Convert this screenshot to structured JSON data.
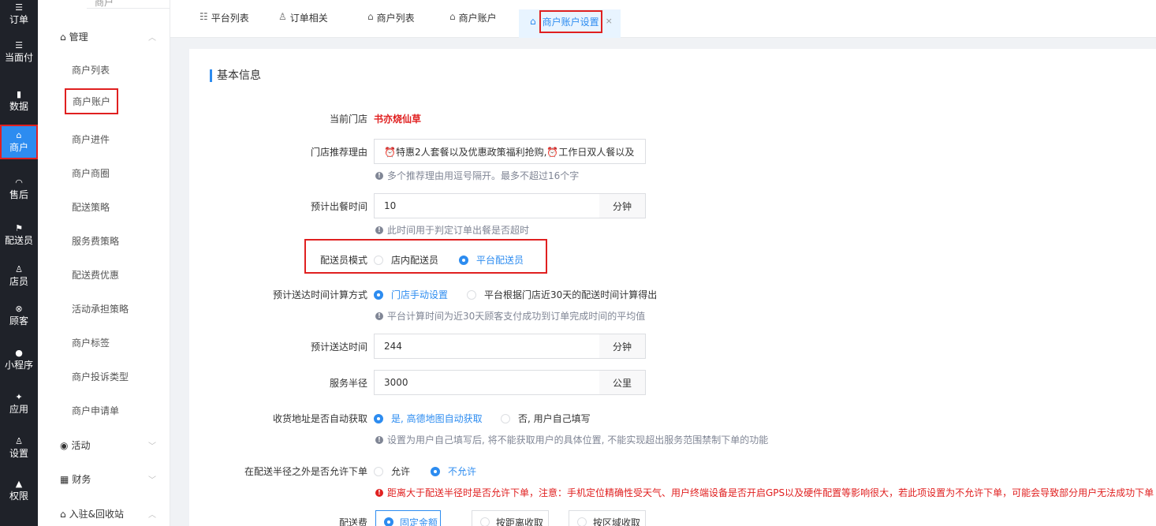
{
  "nav": {
    "items": [
      {
        "icon": "☰",
        "label": "订单"
      },
      {
        "icon": "☰",
        "label": "当面付"
      },
      {
        "icon": "▮",
        "label": "数据"
      },
      {
        "icon": "⌂",
        "label": "商户"
      },
      {
        "icon": "◠",
        "label": "售后"
      },
      {
        "icon": "⚑",
        "label": "配送员"
      },
      {
        "icon": "♙",
        "label": "店员"
      },
      {
        "icon": "⊗",
        "label": "顾客"
      },
      {
        "icon": "●",
        "label": "小程序"
      },
      {
        "icon": "✦",
        "label": "应用"
      },
      {
        "icon": "♙",
        "label": "设置"
      },
      {
        "icon": "▲",
        "label": "权限"
      }
    ],
    "active_index": 3
  },
  "submenu": {
    "top_label": "商户",
    "group_manage": "管理",
    "items": [
      "商户列表",
      "商户账户",
      "商户进件",
      "商户商圈",
      "配送策略",
      "服务费策略",
      "配送费优惠",
      "活动承担策略",
      "商户标签",
      "商户投诉类型",
      "商户申请单"
    ],
    "group_activity": "活动",
    "group_finance": "财务",
    "group_settle": "入驻&回收站"
  },
  "tabs": {
    "items": [
      "平台列表",
      "订单相关",
      "商户列表",
      "商户账户"
    ],
    "active": "商户账户设置",
    "close": "×"
  },
  "form": {
    "section_title": "基本信息",
    "store_label": "当前门店",
    "store_value": "书亦烧仙草",
    "recommend_label": "门店推荐理由",
    "recommend_value": "⏰特惠2人套餐以及优惠政策福利抢购,⏰工作日双人餐以及",
    "recommend_hint": "多个推荐理由用逗号隔开。最多不超过16个字",
    "meal_time_label": "预计出餐时间",
    "meal_time_value": "10",
    "meal_time_unit": "分钟",
    "meal_time_hint": "此时间用于判定订单出餐是否超时",
    "rider_mode_label": "配送员模式",
    "rider_mode_opt1": "店内配送员",
    "rider_mode_opt2": "平台配送员",
    "eta_calc_label": "预计送达时间计算方式",
    "eta_calc_opt1": "门店手动设置",
    "eta_calc_opt2": "平台根据门店近30天的配送时间计算得出",
    "eta_calc_hint": "平台计算时间为近30天顾客支付成功到订单完成时间的平均值",
    "eta_label": "预计送达时间",
    "eta_value": "244",
    "eta_unit": "分钟",
    "radius_label": "服务半径",
    "radius_value": "3000",
    "radius_unit": "公里",
    "auto_addr_label": "收货地址是否自动获取",
    "auto_addr_opt1": "是, 高德地图自动获取",
    "auto_addr_opt2": "否, 用户自己填写",
    "auto_addr_hint": "设置为用户自己填写后, 将不能获取用户的具体位置, 不能实现超出服务范围禁制下单的功能",
    "outside_label": "在配送半径之外是否允许下单",
    "outside_opt1": "允许",
    "outside_opt2": "不允许",
    "outside_hint": "距离大于配送半径时是否允许下单，注意：手机定位精确性受天气、用户终端设备是否开启GPS以及硬件配置等影响很大，若此项设置为不允许下单，可能会导致部分用户无法成功下单",
    "fee_label": "配送费",
    "fee_opt1": "固定金额",
    "fee_opt2": "按距离收取",
    "fee_opt3": "按区域收取"
  },
  "colors": {
    "accent": "#2d8cf0",
    "highlight": "#e02020",
    "nav_bg": "#1f2229"
  }
}
